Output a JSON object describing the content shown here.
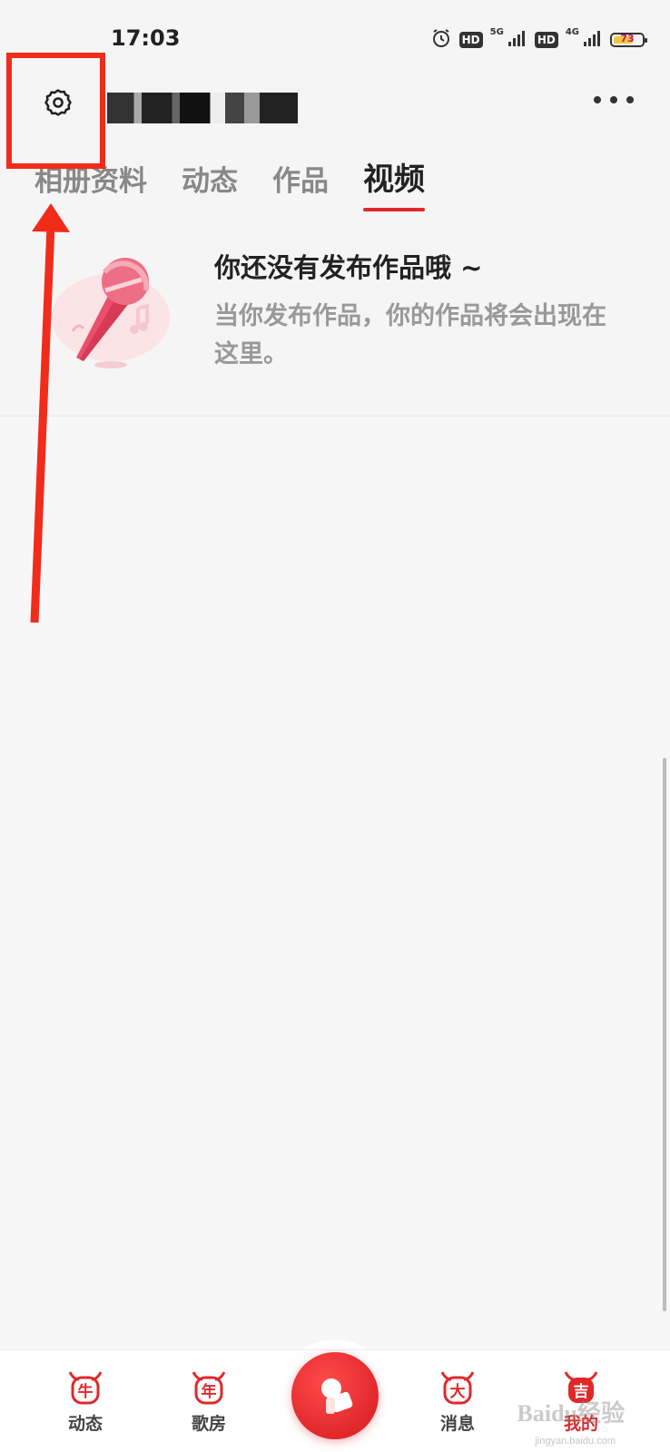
{
  "status_bar": {
    "time": "17:03",
    "hd1": "HD",
    "net1": "5G",
    "hd2": "HD",
    "net2": "4G",
    "battery": "73",
    "battery_level": 0.73,
    "icons": [
      "alarm-icon",
      "signal-icon",
      "battery-icon"
    ]
  },
  "header": {
    "settings_icon": "gear-icon",
    "more_icon": "more-dots-icon"
  },
  "tabs": [
    {
      "label": "相册资料",
      "active": false
    },
    {
      "label": "动态",
      "active": false
    },
    {
      "label": "作品",
      "active": false
    },
    {
      "label": "视频",
      "active": true
    }
  ],
  "empty_state": {
    "title": "你还没有发布作品哦 ~",
    "description": "当你发布作品，你的作品将会出现在这里。",
    "illustration": "microphone-icon"
  },
  "bottom_nav": {
    "items": [
      {
        "label": "动态",
        "badge": "牛",
        "icon": "ox-dynamic-icon"
      },
      {
        "label": "歌房",
        "badge": "年",
        "icon": "ox-room-icon"
      },
      {
        "label": "消息",
        "badge": "大",
        "icon": "ox-message-icon"
      },
      {
        "label": "我的",
        "badge": "吉",
        "icon": "ox-me-icon",
        "active": true
      }
    ],
    "center_icon": "sing-record-icon"
  },
  "watermark": {
    "main": "Baidu经验",
    "sub": "jingyan.baidu.com"
  },
  "colors": {
    "accent": "#e0282b",
    "annotation": "#f12c1b",
    "background": "#f7f7f7"
  }
}
